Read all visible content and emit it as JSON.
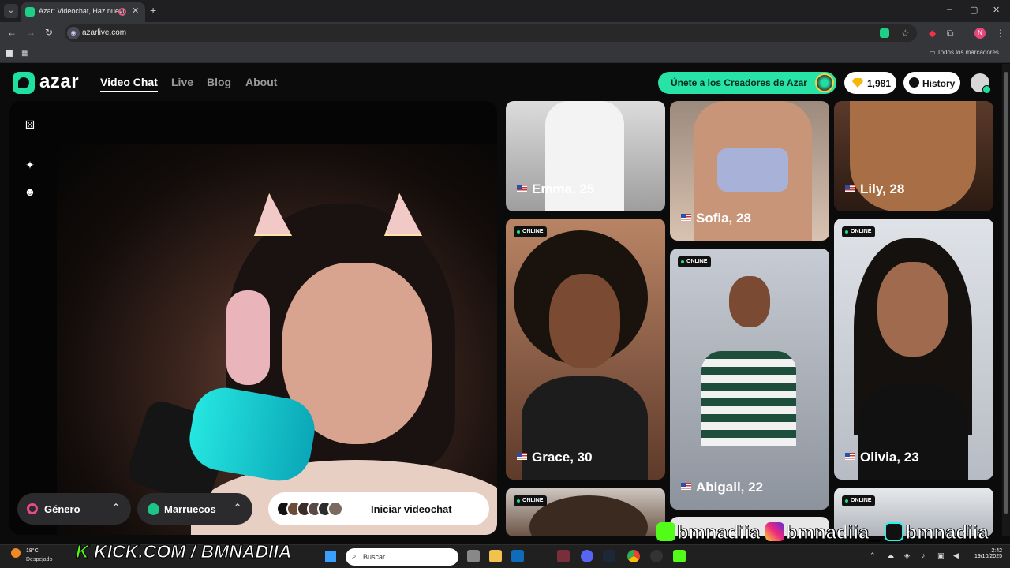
{
  "browser": {
    "tab_title": "Azar: Videochat, Haz nuevo",
    "new_tab": "+",
    "url": "azarlive.com",
    "bookmarks_all": "Todos los marcadores",
    "profile_initial": "N",
    "window_controls": [
      "–",
      "▢",
      "✕"
    ]
  },
  "header": {
    "brand": "azar",
    "nav": [
      "Video Chat",
      "Live",
      "Blog",
      "About"
    ],
    "creators_label": "Únete a los Creadores de Azar",
    "gems": "1,981",
    "history_label": "History"
  },
  "video": {
    "gender_label": "Género",
    "country_label": "Marruecos",
    "start_label": "Iniciar videochat"
  },
  "profiles": [
    {
      "name": "Emma, 25",
      "online": false
    },
    {
      "name": "Sofia, 28",
      "online": false
    },
    {
      "name": "Lily, 28",
      "online": false
    },
    {
      "name": "Grace, 30",
      "online": true
    },
    {
      "name": "Abigail, 22",
      "online": true
    },
    {
      "name": "Olivia, 23",
      "online": true
    }
  ],
  "online_label": "ONLINE",
  "overlay": {
    "kick_handle": "KICK.COM / BMNADIIA",
    "social_kick": "bmnadiia",
    "social_ig": "bmnadiia_",
    "social_tiktok": "bmnadiia"
  },
  "taskbar": {
    "temp": "18°C",
    "weather": "Despejado",
    "search_placeholder": "Buscar",
    "time": "2:42",
    "date": "19/10/2025"
  },
  "colors": {
    "accent": "#27e3a6",
    "online": "#20e07f",
    "kick": "#53fc18"
  }
}
